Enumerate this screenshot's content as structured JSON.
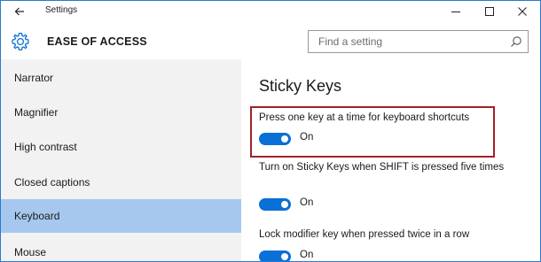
{
  "window": {
    "title": "Settings",
    "controls": {
      "minimize": "–",
      "maximize": "☐",
      "close": "✕"
    }
  },
  "header": {
    "section_title": "EASE OF ACCESS",
    "search_placeholder": "Find a setting",
    "gear_icon": "gear-icon",
    "search_icon": "search-icon"
  },
  "sidebar": {
    "items": [
      {
        "label": "Narrator",
        "selected": false
      },
      {
        "label": "Magnifier",
        "selected": false
      },
      {
        "label": "High contrast",
        "selected": false
      },
      {
        "label": "Closed captions",
        "selected": false
      },
      {
        "label": "Keyboard",
        "selected": true
      },
      {
        "label": "Mouse",
        "selected": false
      }
    ]
  },
  "content": {
    "title": "Sticky Keys",
    "options": [
      {
        "label": "Press one key at a time for keyboard shortcuts",
        "state": "On",
        "on": true,
        "highlighted": true
      },
      {
        "label": "Turn on Sticky Keys when SHIFT is pressed five times",
        "state": "On",
        "on": true,
        "highlighted": false
      },
      {
        "label": "Lock modifier key when pressed twice in a row",
        "state": "On",
        "on": true,
        "highlighted": false
      }
    ]
  },
  "colors": {
    "accent": "#0a6fd6",
    "sidebar_bg": "#f2f2f2",
    "selected_bg": "#a6c8ef",
    "highlight_border": "#a4202a",
    "window_border": "#2b79d0"
  }
}
